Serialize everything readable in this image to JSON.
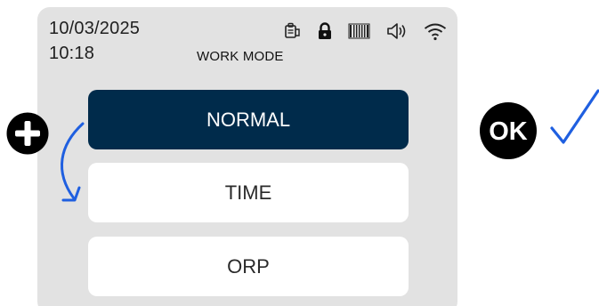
{
  "status_bar": {
    "date": "10/03/2025",
    "time": "10:18",
    "icons": [
      "clipboard-hand-icon",
      "lock-icon",
      "barcode-battery-icon",
      "speaker-icon",
      "wifi-icon"
    ]
  },
  "header": {
    "title": "WORK MODE"
  },
  "modes": [
    {
      "label": "NORMAL",
      "selected": true
    },
    {
      "label": "TIME",
      "selected": false
    },
    {
      "label": "ORP",
      "selected": false
    }
  ],
  "keys": {
    "plus": "plus-key-icon",
    "ok": "OK"
  },
  "colors": {
    "panel": "#e2e2e2",
    "selected": "#002b4b",
    "annotation_blue": "#1f5fe0"
  }
}
